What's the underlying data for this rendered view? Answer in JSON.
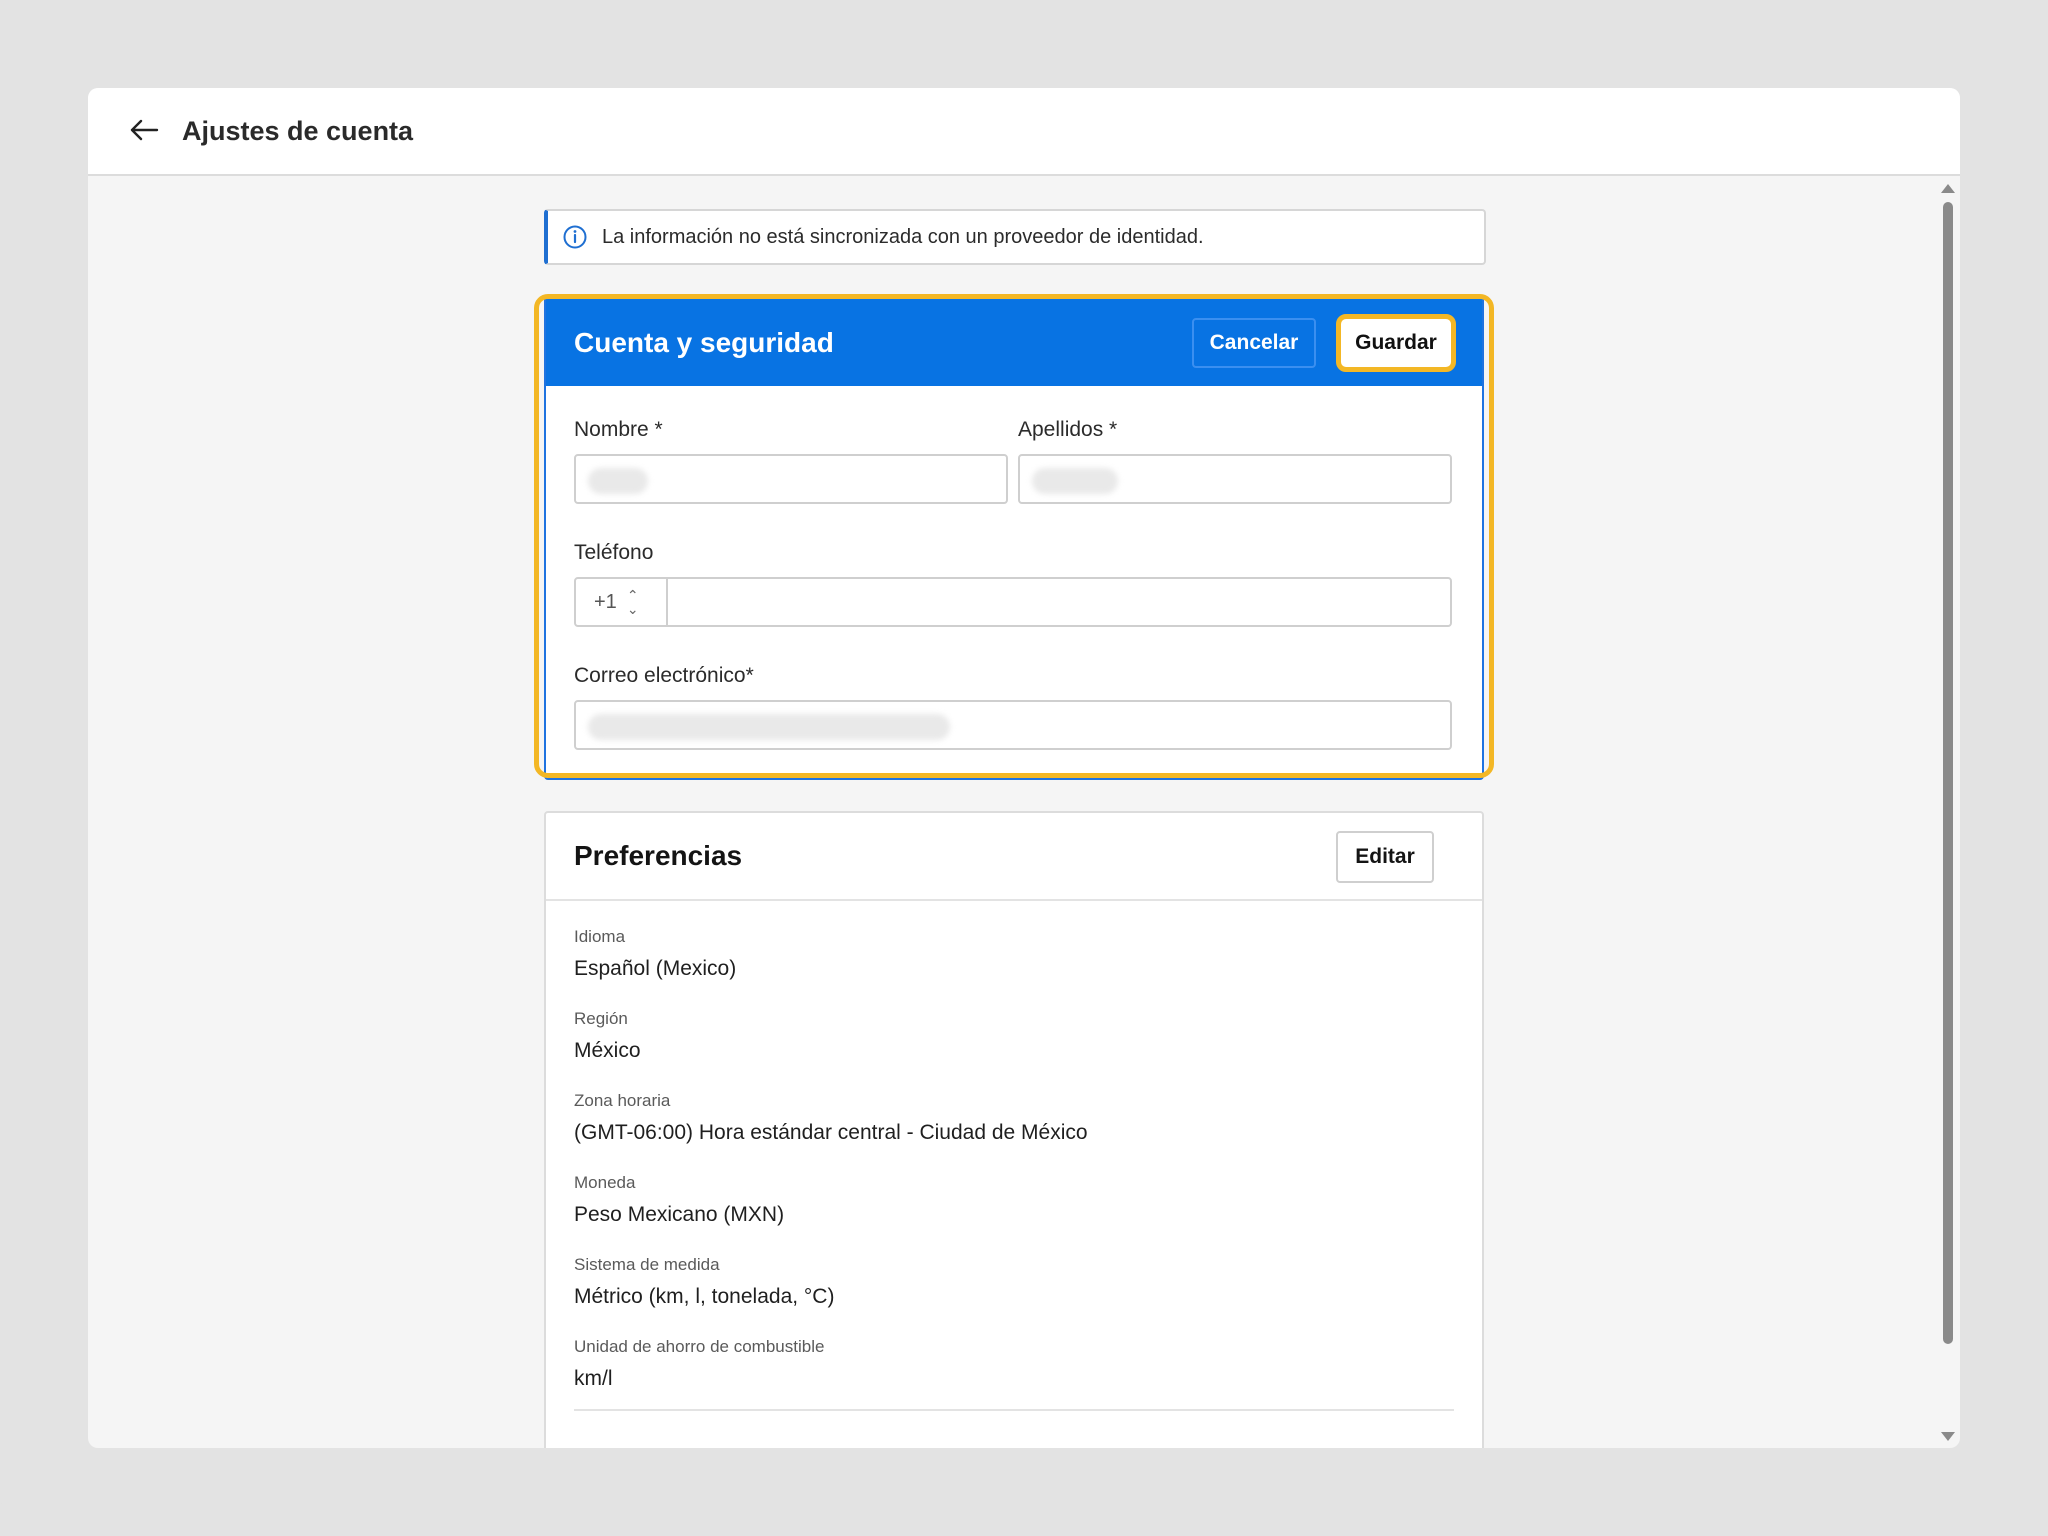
{
  "header": {
    "title": "Ajustes de cuenta"
  },
  "info_banner": {
    "text": "La información no está sincronizada con un proveedor de identidad."
  },
  "account_card": {
    "title": "Cuenta y seguridad",
    "cancel_label": "Cancelar",
    "save_label": "Guardar",
    "fields": {
      "first_name_label": "Nombre *",
      "last_name_label": "Apellidos *",
      "phone_label": "Teléfono",
      "phone_country_code": "+1",
      "email_label": "Correo electrónico*"
    }
  },
  "preferences_card": {
    "title": "Preferencias",
    "edit_label": "Editar",
    "items": [
      {
        "label": "Idioma",
        "value": "Español (Mexico)"
      },
      {
        "label": "Región",
        "value": "México"
      },
      {
        "label": "Zona horaria",
        "value": "(GMT-06:00) Hora estándar central - Ciudad de México"
      },
      {
        "label": "Moneda",
        "value": "Peso Mexicano (MXN)"
      },
      {
        "label": "Sistema de medida",
        "value": "Métrico (km, l, tonelada, °C)"
      },
      {
        "label": "Unidad de ahorro de combustible",
        "value": "km/l"
      }
    ]
  },
  "colors": {
    "accent": "#0873e3",
    "highlight": "#f3b725"
  },
  "icons": {
    "back": "arrow-left-icon",
    "info": "info-circle-icon",
    "phone_select": "chevron-up-down-icon"
  }
}
